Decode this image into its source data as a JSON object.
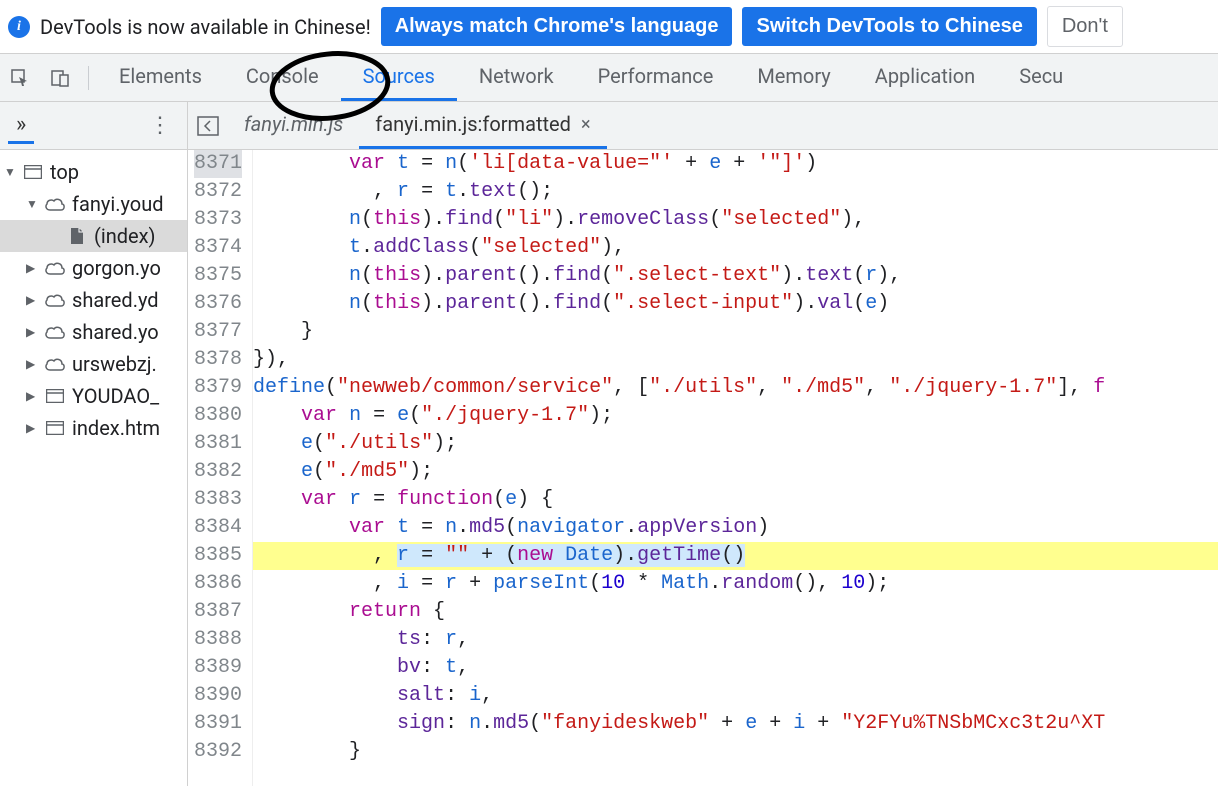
{
  "notification": {
    "text": "DevTools is now available in Chinese!",
    "btn_match": "Always match Chrome's language",
    "btn_switch": "Switch DevTools to Chinese",
    "btn_dont": "Don't"
  },
  "panel_tabs": [
    "Elements",
    "Console",
    "Sources",
    "Network",
    "Performance",
    "Memory",
    "Application",
    "Secu"
  ],
  "panel_active_index": 2,
  "sidebar_toggle_glyph": "»",
  "sidebar_more_glyph": "⋮",
  "tree": [
    {
      "depth": 0,
      "caret": "▼",
      "iconType": "window",
      "label": "top"
    },
    {
      "depth": 1,
      "caret": "▼",
      "iconType": "cloud",
      "label": "fanyi.youd"
    },
    {
      "depth": 2,
      "caret": "",
      "iconType": "file",
      "label": "(index)",
      "selected": true
    },
    {
      "depth": 1,
      "caret": "▶",
      "iconType": "cloud",
      "label": "gorgon.yo"
    },
    {
      "depth": 1,
      "caret": "▶",
      "iconType": "cloud",
      "label": "shared.yd"
    },
    {
      "depth": 1,
      "caret": "▶",
      "iconType": "cloud",
      "label": "shared.yo"
    },
    {
      "depth": 1,
      "caret": "▶",
      "iconType": "cloud",
      "label": "urswebzj."
    },
    {
      "depth": 1,
      "caret": "▶",
      "iconType": "window",
      "label": "YOUDAO_"
    },
    {
      "depth": 1,
      "caret": "▶",
      "iconType": "window",
      "label": "index.htm"
    }
  ],
  "file_tabs": [
    {
      "label": "fanyi.min.js",
      "italic": true,
      "close": false
    },
    {
      "label": "fanyi.min.js:formatted",
      "italic": false,
      "close": true
    }
  ],
  "file_tab_active_index": 1,
  "gutter_start": 8371,
  "gutter_end": 8392,
  "highlight_line": 8385,
  "gutter_box_line": 8371,
  "code_lines": [
    {
      "n": 8371,
      "html": "        <span class='kw'>var</span> <span class='def'>t</span> = <span class='def'>n</span>(<span class='str'>'li[data-value=\"'</span> + <span class='def'>e</span> + <span class='str'>'\"]'</span>)"
    },
    {
      "n": 8372,
      "html": "          , <span class='def'>r</span> = <span class='def'>t</span>.<span class='prop'>text</span>();"
    },
    {
      "n": 8373,
      "html": "        <span class='def'>n</span>(<span class='kw'>this</span>).<span class='prop'>find</span>(<span class='str'>\"li\"</span>).<span class='prop'>removeClass</span>(<span class='str'>\"selected\"</span>),"
    },
    {
      "n": 8374,
      "html": "        <span class='def'>t</span>.<span class='prop'>addClass</span>(<span class='str'>\"selected\"</span>),"
    },
    {
      "n": 8375,
      "html": "        <span class='def'>n</span>(<span class='kw'>this</span>).<span class='prop'>parent</span>().<span class='prop'>find</span>(<span class='str'>\".select-text\"</span>).<span class='prop'>text</span>(<span class='def'>r</span>),"
    },
    {
      "n": 8376,
      "html": "        <span class='def'>n</span>(<span class='kw'>this</span>).<span class='prop'>parent</span>().<span class='prop'>find</span>(<span class='str'>\".select-input\"</span>).<span class='prop'>val</span>(<span class='def'>e</span>)"
    },
    {
      "n": 8377,
      "html": "    }"
    },
    {
      "n": 8378,
      "html": "}),"
    },
    {
      "n": 8379,
      "html": "<span class='def'>define</span>(<span class='str'>\"newweb/common/service\"</span>, [<span class='str'>\"./utils\"</span>, <span class='str'>\"./md5\"</span>, <span class='str'>\"./jquery-1.7\"</span>], <span class='kw'>f</span>"
    },
    {
      "n": 8380,
      "html": "    <span class='kw'>var</span> <span class='def'>n</span> = <span class='def'>e</span>(<span class='str'>\"./jquery-1.7\"</span>);"
    },
    {
      "n": 8381,
      "html": "    <span class='def'>e</span>(<span class='str'>\"./utils\"</span>);"
    },
    {
      "n": 8382,
      "html": "    <span class='def'>e</span>(<span class='str'>\"./md5\"</span>);"
    },
    {
      "n": 8383,
      "html": "    <span class='kw'>var</span> <span class='def'>r</span> = <span class='kw'>function</span>(<span class='def'>e</span>) {"
    },
    {
      "n": 8384,
      "html": "        <span class='kw'>var</span> <span class='def'>t</span> = <span class='def'>n</span>.<span class='prop'>md5</span>(<span class='def'>navigator</span>.<span class='prop'>appVersion</span>)"
    },
    {
      "n": 8385,
      "html": "          , <span class='sel-blue'><span class='def'>r</span> = <span class='str'>\"\"</span> + (<span class='kw'>new</span> <span class='def'>Date</span>).<span class='prop'>getTime</span>()</span>",
      "hl": true
    },
    {
      "n": 8386,
      "html": "          , <span class='def'>i</span> = <span class='def'>r</span> + <span class='def'>parseInt</span>(<span class='num'>10</span> * <span class='def'>Math</span>.<span class='prop'>random</span>(), <span class='num'>10</span>);"
    },
    {
      "n": 8387,
      "html": "        <span class='kw'>return</span> {"
    },
    {
      "n": 8388,
      "html": "            <span class='prop'>ts</span>: <span class='def'>r</span>,"
    },
    {
      "n": 8389,
      "html": "            <span class='prop'>bv</span>: <span class='def'>t</span>,"
    },
    {
      "n": 8390,
      "html": "            <span class='prop'>salt</span>: <span class='def'>i</span>,"
    },
    {
      "n": 8391,
      "html": "            <span class='prop'>sign</span>: <span class='def'>n</span>.<span class='prop'>md5</span>(<span class='str'>\"fanyideskweb\"</span> + <span class='def'>e</span> + <span class='def'>i</span> + <span class='str'>\"Y2FYu%TNSbMCxc3t2u^XT</span>"
    },
    {
      "n": 8392,
      "html": "        }"
    }
  ]
}
